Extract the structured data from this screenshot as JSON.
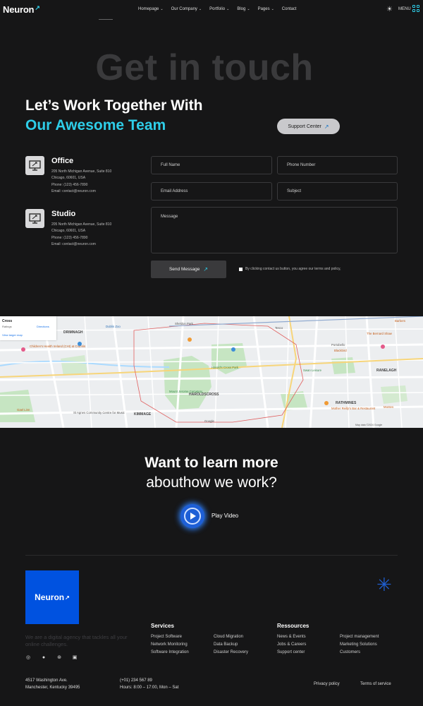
{
  "header": {
    "logo": "Neuron",
    "nav": [
      "Homepage",
      "Our Company",
      "Portfolio",
      "Blog",
      "Pages",
      "Contact"
    ],
    "menu_label": "MENU"
  },
  "hero": {
    "big_title": "Get in touch",
    "heading_line1": "Let’s Work Together With",
    "heading_line2": "Our Awesome Team",
    "support_button": "Support Center"
  },
  "offices": [
    {
      "title": "Office",
      "address1": "205 North Michigan Avenue, Suite 810",
      "address2": "Chicago, 60601, USA",
      "phone": "Phone: (123) 456-7890",
      "email": "Email: contact@neuron.com"
    },
    {
      "title": "Studio",
      "address1": "205 North Michigan Avenue, Suite 810",
      "address2": "Chicago, 60601, USA",
      "phone": "Phone: (123) 456-7890",
      "email": "Email: contact@neuron.com"
    }
  ],
  "form": {
    "full_name": "Full Name",
    "phone": "Phone Number",
    "email": "Email Address",
    "subject": "Subject",
    "message": "Message",
    "send_button": "Send Message",
    "agree_text": "By clicking contact us button, you agree our terms and policy,"
  },
  "map": {
    "labels": [
      "DRIMNAGH",
      "Children's Health Ireland (CHI) at Crumlin",
      "HAROLDSCROSS",
      "KIMMAGE",
      "RATHMINES",
      "RANELAGH",
      "Portobello",
      "St Agnes Community Centre for Music",
      "Swan Leisure",
      "Dublin Zoo",
      "Gael Linn",
      "Sheldon Park",
      "Blackbird",
      "Harold's Cross Park",
      "Mount Jerome Cemetery",
      "Mother Reilly's Bar & Restaurant",
      "Montes",
      "Barbers",
      "The Bernard Shaw",
      "Tesco"
    ],
    "card_label1": "Cross",
    "card_label2": "Directions",
    "card_link": "View larger map",
    "card_rating": "Ratings",
    "footer": "Map data ©2024 Google",
    "google": "Google"
  },
  "video": {
    "line1": "Want to learn more",
    "line2": "abouthow we work?",
    "play_label": "Play Video"
  },
  "footer": {
    "logo": "Neuron",
    "tagline": "We are a digital agency that tackles all your online challenges.",
    "services_title": "Services",
    "services_col1": [
      "Project Software",
      "Network Monitoring",
      "Software Integration"
    ],
    "services_col2": [
      "Cloud Migration",
      "Data Backup",
      "Disaster Recovery"
    ],
    "resources_title": "Ressources",
    "resources_col1": [
      "News & Events",
      "Jobs & Careers",
      "Support center"
    ],
    "resources_col2": [
      "Project management",
      "Marketing Solutions",
      "Customers"
    ],
    "address1": "4517 Washington Ave.",
    "address2": "Manchester, Kentucky 39495",
    "phone": "(+01) 234 567 89",
    "hours": "Hours: 8:00 – 17:00, Mon – Sat",
    "privacy": "Privacy policy",
    "terms": "Terms of service"
  },
  "colors": {
    "background": "#161617",
    "accent": "#2ecde8",
    "brand_blue": "#0052e0"
  }
}
